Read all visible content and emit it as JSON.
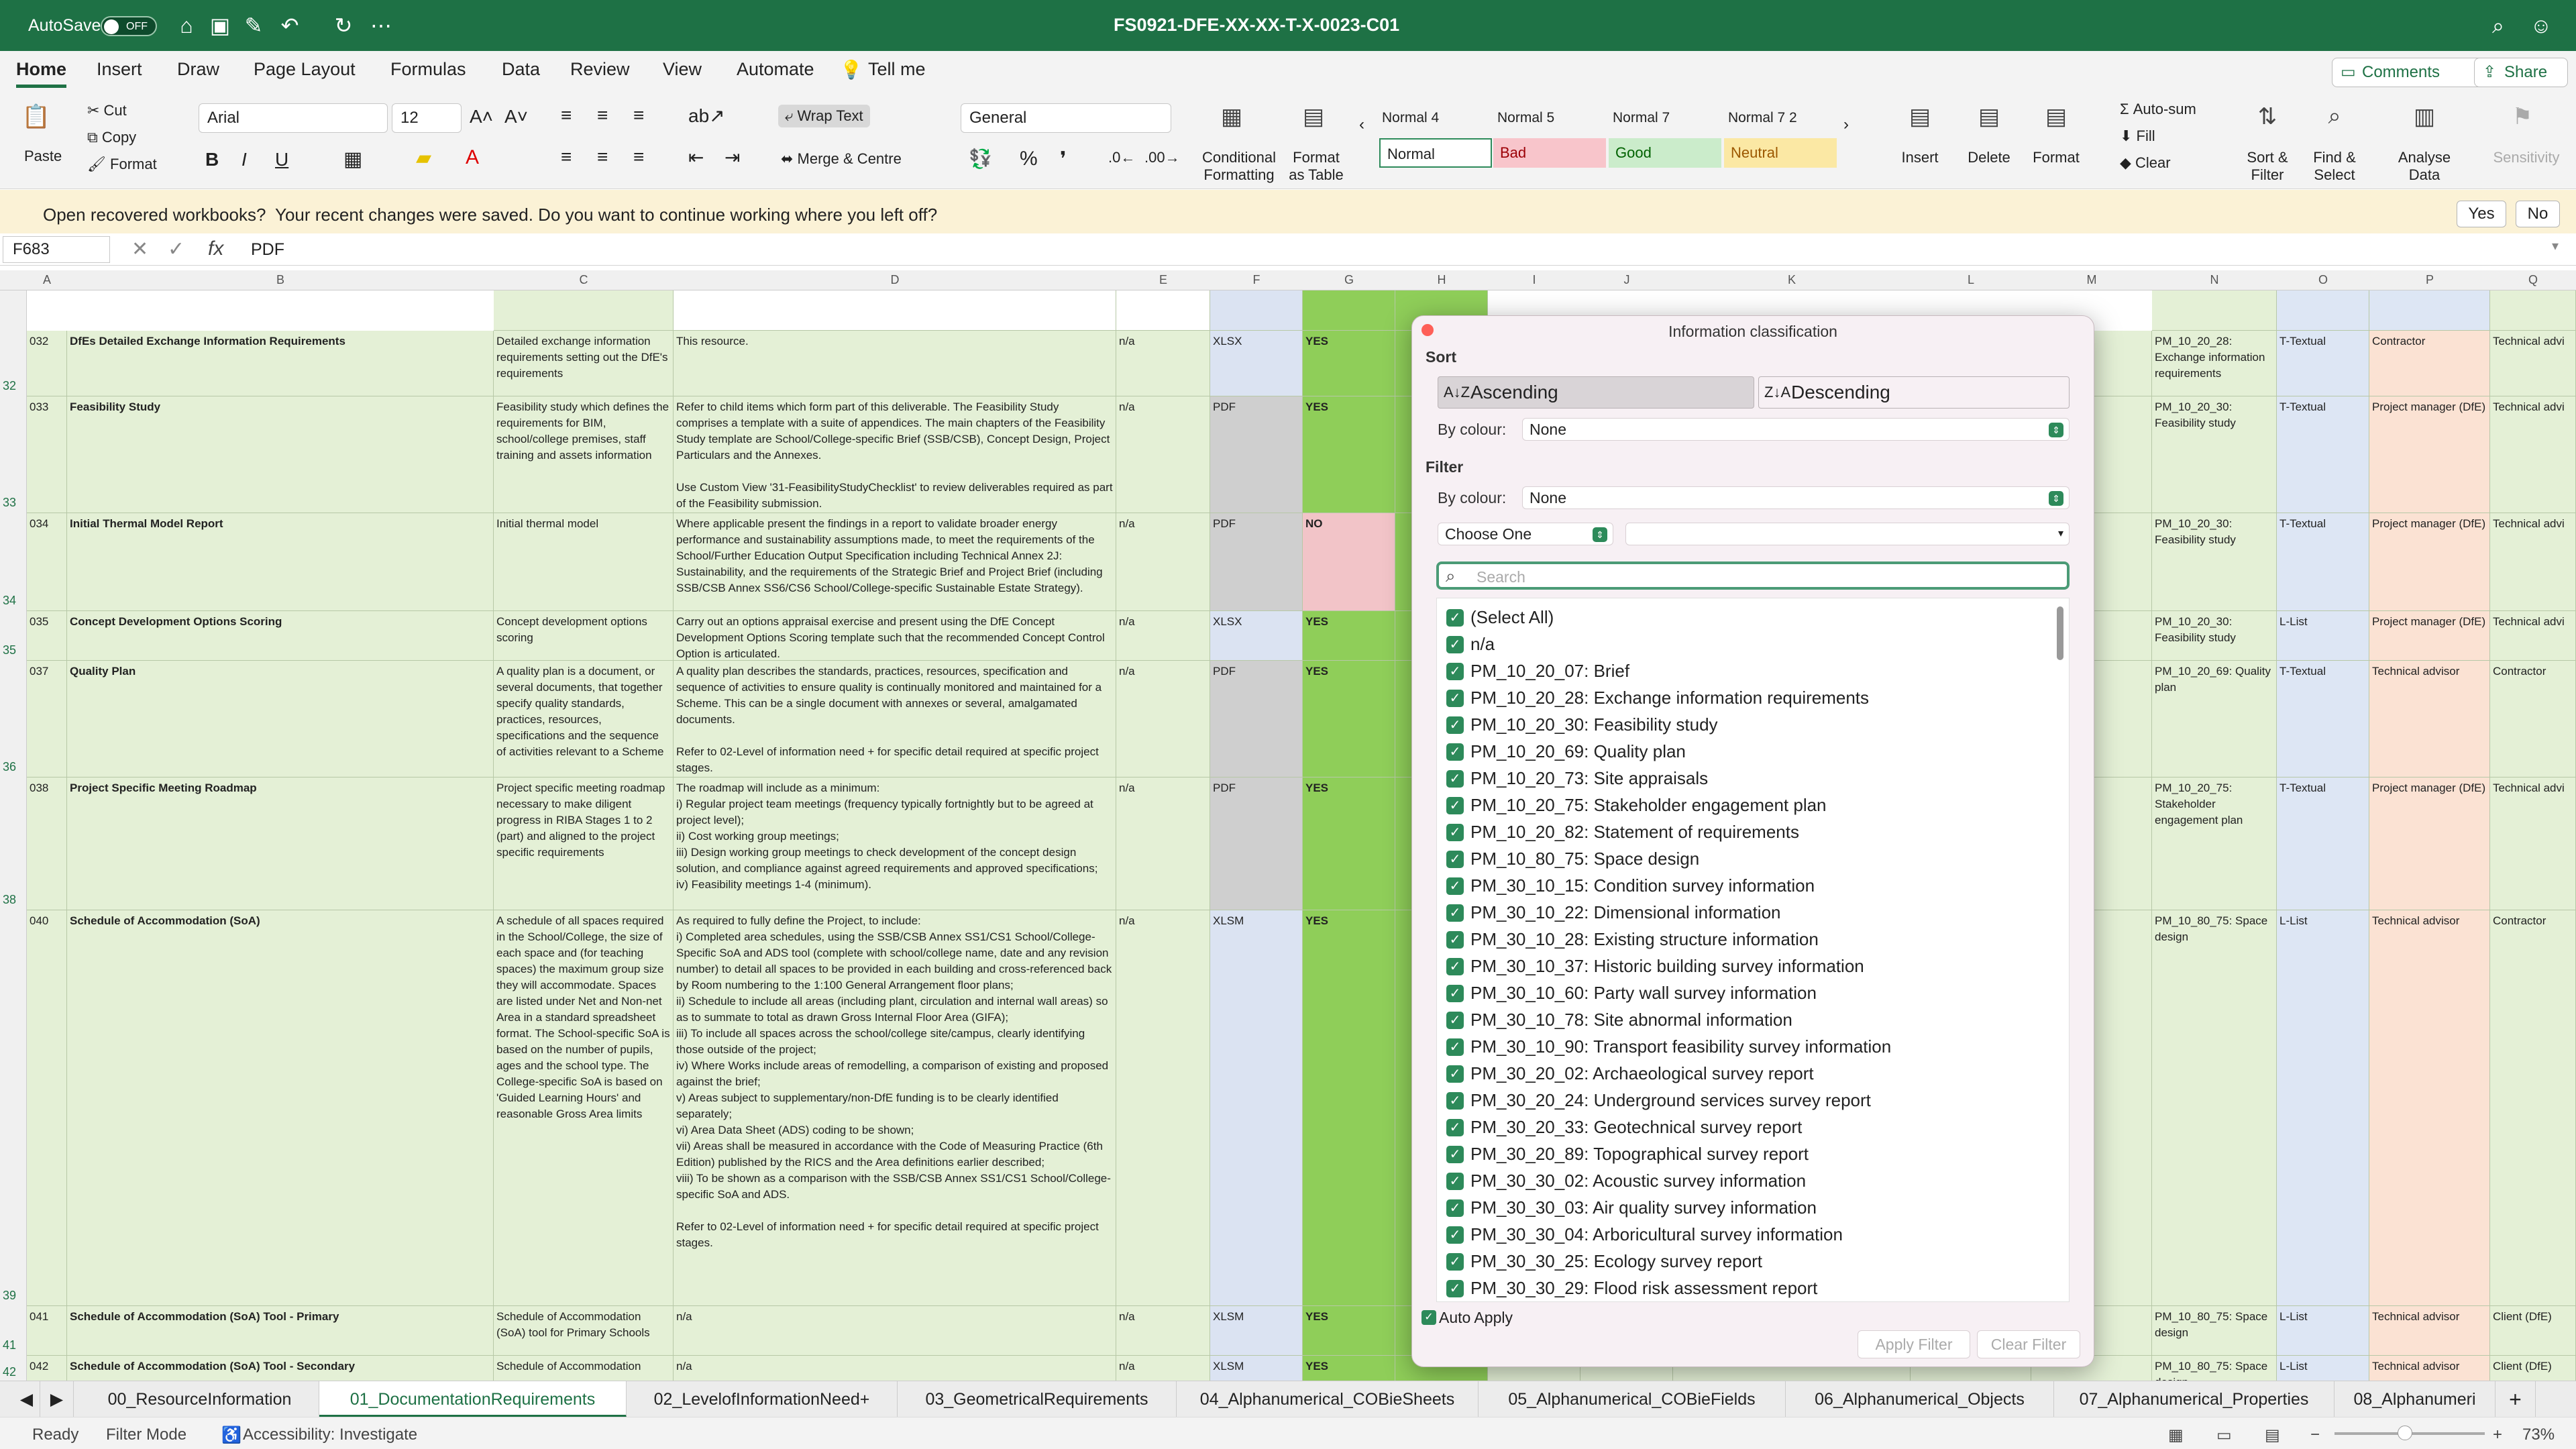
{
  "titlebar": {
    "autosave": "AutoSave",
    "toggle": "OFF",
    "document_title": "FS0921-DFE-XX-XX-T-X-0023-C01"
  },
  "tabs": [
    "Home",
    "Insert",
    "Draw",
    "Page Layout",
    "Formulas",
    "Data",
    "Review",
    "View",
    "Automate",
    "Tell me"
  ],
  "header_buttons": {
    "comments": "Comments",
    "share": "Share"
  },
  "ribbon": {
    "paste": "Paste",
    "cut": "Cut",
    "copy": "Copy",
    "format": "Format",
    "font": "Arial",
    "size": "12",
    "wrap": "Wrap Text",
    "merge": "Merge & Centre",
    "number_format": "General",
    "cond_fmt": "Conditional Formatting",
    "fmt_table": "Format as Table",
    "styles": [
      {
        "name": "Normal 4",
        "sample": "Normal",
        "bg": "#ffffff"
      },
      {
        "name": "Normal 5",
        "sample": "Bad",
        "bg": "#f8c5cb"
      },
      {
        "name": "Normal 7",
        "sample": "Good",
        "bg": "#cbeccb"
      },
      {
        "name": "Normal 7 2",
        "sample": "Neutral",
        "bg": "#fbe8a4"
      }
    ],
    "insert": "Insert",
    "delete": "Delete",
    "format2": "Format",
    "autosum": "Auto-sum",
    "fill": "Fill",
    "clear": "Clear",
    "sort_filter": "Sort & Filter",
    "find_select": "Find & Select",
    "analyse": "Analyse Data",
    "sensitivity": "Sensitivity"
  },
  "notice": {
    "title": "Open recovered workbooks?",
    "message": "Your recent changes were saved. Do you want to continue working where you left off?",
    "yes": "Yes",
    "no": "No"
  },
  "formula_bar": {
    "name_box": "F683",
    "value": "PDF"
  },
  "columns": [
    "A",
    "B",
    "C",
    "D",
    "E",
    "F",
    "G",
    "H",
    "I",
    "J",
    "K",
    "L",
    "M",
    "N",
    "O",
    "P",
    "Q"
  ],
  "rows": [
    {
      "num": "32",
      "id": "032",
      "name": "DfEs Detailed Exchange Information Requirements",
      "desc": "Detailed exchange information requirements setting out the DfE's requirements",
      "detail": "This resource.",
      "e": "n/a",
      "f": "XLSX",
      "g": "YES",
      "n": "PM_10_20_28: Exchange information requirements",
      "o": "T-Textual",
      "p": "Contractor",
      "q": "Technical advi"
    },
    {
      "num": "33",
      "id": "033",
      "name": "Feasibility Study",
      "desc": "Feasibility study which defines the requirements for BIM, school/college premises, staff training and assets information",
      "detail": "Refer to child items which form part of this deliverable. The Feasibility Study comprises a template with a suite of appendices. The main chapters of the Feasibility Study template are School/College-specific Brief (SSB/CSB), Concept Design, Project Particulars and the Annexes.\n\nUse Custom View '31-FeasibilityStudyChecklist' to review deliverables required as part of the Feasibility submission.",
      "e": "n/a",
      "f": "PDF",
      "g": "YES",
      "n": "PM_10_20_30: Feasibility study",
      "o": "T-Textual",
      "p": "Project manager (DfE)",
      "q": "Technical advi"
    },
    {
      "num": "34",
      "id": "034",
      "name": "Initial Thermal Model Report",
      "desc": "Initial thermal model",
      "detail": "Where applicable present the findings in a report to validate broader energy performance and sustainability assumptions made, to meet the requirements of the School/Further Education Output Specification including Technical Annex 2J: Sustainability, and the requirements of the Strategic Brief and Project Brief (including SSB/CSB Annex SS6/CS6 School/College-specific Sustainable Estate Strategy).",
      "e": "n/a",
      "f": "PDF",
      "g": "NO",
      "n": "PM_10_20_30: Feasibility study",
      "o": "T-Textual",
      "p": "Project manager (DfE)",
      "q": "Technical advi"
    },
    {
      "num": "35",
      "id": "035",
      "name": "Concept Development Options Scoring",
      "desc": "Concept development options scoring",
      "detail": "Carry out an options appraisal exercise and present using the DfE Concept Development Options Scoring template such that the recommended Concept Control Option is articulated.",
      "e": "n/a",
      "f": "XLSX",
      "g": "YES",
      "n": "PM_10_20_30: Feasibility study",
      "o": "L-List",
      "p": "Project manager (DfE)",
      "q": "Technical advi"
    },
    {
      "num": "36",
      "id": "037",
      "name": "Quality Plan",
      "desc": "A quality plan is a document, or several documents, that together specify quality standards, practices, resources, specifications and the sequence of activities relevant to a Scheme",
      "detail": "A quality plan describes the standards, practices, resources, specification and sequence of activities to ensure quality is continually monitored and maintained for a Scheme. This can be a single document with annexes or several, amalgamated documents.\n\nRefer to 02-Level of information need + for specific detail required at specific project stages.",
      "e": "n/a",
      "f": "PDF",
      "g": "YES",
      "n": "PM_10_20_69: Quality plan",
      "o": "T-Textual",
      "p": "Technical advisor",
      "q": "Contractor"
    },
    {
      "num": "38",
      "id": "038",
      "name": "Project Specific Meeting Roadmap",
      "desc": "Project specific meeting roadmap necessary to make diligent progress in RIBA Stages 1 to 2 (part) and aligned to the project specific requirements",
      "detail": "The roadmap will include as a minimum:\ni) Regular project team meetings (frequency typically fortnightly but to be agreed at project level);\nii) Cost working group meetings;\niii) Design working group meetings to check development of the concept design solution, and compliance against agreed requirements and approved specifications;\niv) Feasibility meetings 1-4 (minimum).",
      "e": "n/a",
      "f": "PDF",
      "g": "YES",
      "n": "PM_10_20_75: Stakeholder engagement plan",
      "o": "T-Textual",
      "p": "Project manager (DfE)",
      "q": "Technical advi"
    },
    {
      "num": "39",
      "id": "040",
      "name": "Schedule of Accommodation (SoA)",
      "desc": "A schedule of all spaces required in the School/College, the size of each space and (for teaching spaces) the maximum group size they will accommodate. Spaces are listed under Net and Non-net Area in a standard spreadsheet format. The School-specific SoA is based on the number of pupils, ages and the school type. The College-specific SoA is based on 'Guided Learning Hours' and reasonable Gross Area limits",
      "detail": "As required to fully define the Project, to include:\ni) Completed area schedules, using the SSB/CSB Annex SS1/CS1 School/College-Specific SoA and ADS tool (complete with school/college name, date and any revision number) to detail all spaces to be provided in each building and cross-referenced back by Room numbering to the 1:100 General Arrangement floor plans;\nii) Schedule to include all areas (including plant, circulation and internal wall areas) so as to summate to total as drawn Gross Internal Floor Area (GIFA);\niii) To include all spaces across the school/college site/campus, clearly identifying those outside of the project;\niv) Where Works include areas of remodelling, a comparison of existing and proposed against the brief;\nv) Areas subject to supplementary/non-DfE funding is to be clearly identified separately;\nvi) Area Data Sheet (ADS) coding to be shown;\nvii) Areas shall be measured in accordance with the Code of Measuring Practice (6th Edition) published by the RICS and the Area definitions earlier described;\nviii) To be shown as a comparison with the SSB/CSB Annex SS1/CS1 School/College-specific SoA and ADS.\n\nRefer to 02-Level of information need + for specific detail required at specific project stages.",
      "e": "n/a",
      "f": "XLSM",
      "g": "YES",
      "n": "PM_10_80_75: Space design",
      "o": "L-List",
      "p": "Technical advisor",
      "q": "Contractor"
    },
    {
      "num": "41",
      "id": "041",
      "name": "Schedule of Accommodation (SoA) Tool - Primary",
      "desc": "Schedule of Accommodation (SoA) tool for Primary Schools",
      "detail": "n/a",
      "e": "n/a",
      "f": "XLSM",
      "g": "YES",
      "n": "PM_10_80_75: Space design",
      "o": "L-List",
      "p": "Technical advisor",
      "q": "Client (DfE)"
    },
    {
      "num": "42",
      "id": "042",
      "name": "Schedule of Accommodation (SoA) Tool - Secondary",
      "desc": "Schedule of Accommodation",
      "detail": "n/a",
      "e": "n/a",
      "f": "XLSM",
      "g": "YES",
      "n": "PM_10_80_75: Space design",
      "o": "L-List",
      "p": "Technical advisor",
      "q": "Client (DfE)"
    }
  ],
  "panel": {
    "title": "Information classification",
    "sort": "Sort",
    "ascending": "Ascending",
    "descending": "Descending",
    "by_colour": "By colour:",
    "none": "None",
    "filter": "Filter",
    "choose_one": "Choose One",
    "search_placeholder": "Search",
    "items": [
      "(Select All)",
      "n/a",
      "PM_10_20_07: Brief",
      "PM_10_20_28: Exchange information requirements",
      "PM_10_20_30: Feasibility study",
      "PM_10_20_69: Quality plan",
      "PM_10_20_73: Site appraisals",
      "PM_10_20_75: Stakeholder engagement plan",
      "PM_10_20_82: Statement of requirements",
      "PM_10_80_75: Space design",
      "PM_30_10_15: Condition survey information",
      "PM_30_10_22: Dimensional information",
      "PM_30_10_28: Existing structure information",
      "PM_30_10_37: Historic building survey information",
      "PM_30_10_60: Party wall survey information",
      "PM_30_10_78: Site abnormal information",
      "PM_30_10_90: Transport feasibility survey information",
      "PM_30_20_02: Archaeological survey report",
      "PM_30_20_24: Underground services survey report",
      "PM_30_20_33: Geotechnical survey report",
      "PM_30_20_89: Topographical survey report",
      "PM_30_30_02: Acoustic survey information",
      "PM_30_30_03: Air quality survey information",
      "PM_30_30_04: Arboricultural survey information",
      "PM_30_30_25: Ecology survey report",
      "PM_30_30_29: Flood risk assessment report"
    ],
    "auto_apply": "Auto Apply",
    "apply": "Apply Filter",
    "clear": "Clear Filter"
  },
  "sheets": [
    "00_ResourceInformation",
    "01_DocumentationRequirements",
    "02_LevelofInformationNeed+",
    "03_GeometricalRequirements",
    "04_Alphanumerical_COBieSheets",
    "05_Alphanumerical_COBieFields",
    "06_Alphanumerical_Objects",
    "07_Alphanumerical_Properties",
    "08_Alphanumeri"
  ],
  "status": {
    "ready": "Ready",
    "mode": "Filter Mode",
    "accessibility": "Accessibility: Investigate",
    "zoom": "73%"
  }
}
